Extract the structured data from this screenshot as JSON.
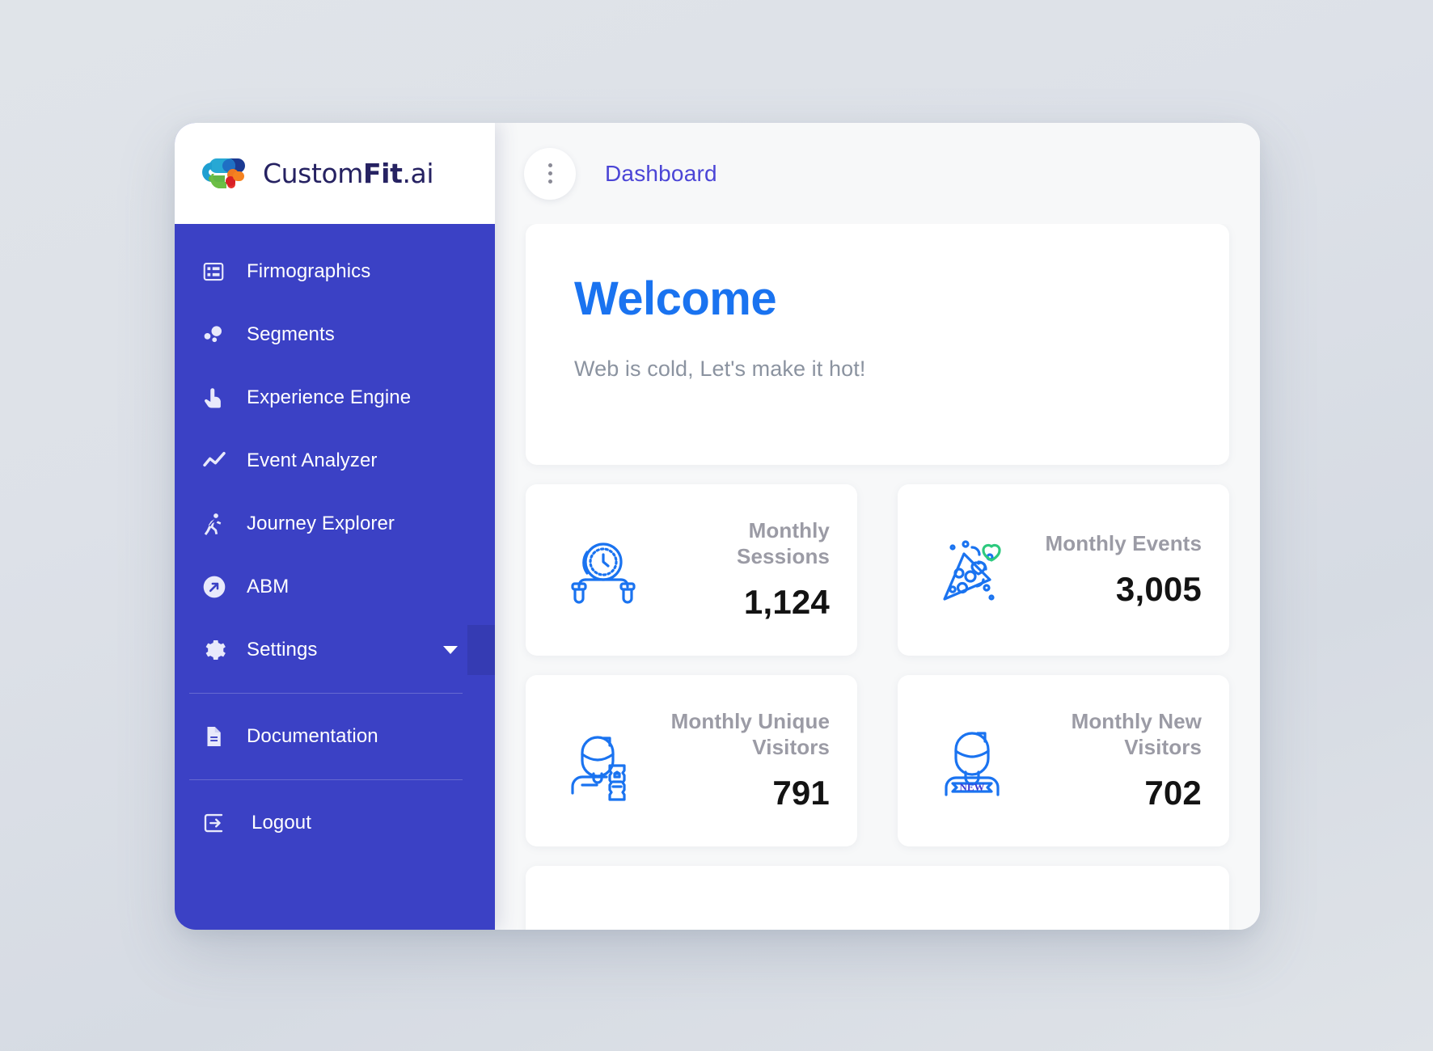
{
  "brand": {
    "name_light": "Custom",
    "name_bold": "Fit",
    "name_suffix": ".ai",
    "logo_icon": "customfit-logo-icon"
  },
  "sidebar": {
    "background_color": "#3b41c5",
    "items": [
      {
        "label": "Firmographics",
        "icon": "list-table-icon"
      },
      {
        "label": "Segments",
        "icon": "bubbles-icon"
      },
      {
        "label": "Experience Engine",
        "icon": "hand-pointer-icon"
      },
      {
        "label": "Event Analyzer",
        "icon": "line-chart-icon"
      },
      {
        "label": "Journey Explorer",
        "icon": "running-person-icon"
      },
      {
        "label": "ABM",
        "icon": "arrow-up-right-circle-icon"
      },
      {
        "label": "Settings",
        "icon": "gear-icon",
        "has_dropdown": true,
        "caret_icon": "chevron-down-icon"
      }
    ],
    "secondary_items": [
      {
        "label": "Documentation",
        "icon": "document-icon"
      }
    ],
    "footer_items": [
      {
        "label": "Logout",
        "icon": "logout-arrow-icon"
      }
    ]
  },
  "topbar": {
    "menu_icon": "kebab-menu-icon",
    "breadcrumb": "Dashboard",
    "breadcrumb_color": "#4b45d6"
  },
  "welcome": {
    "title": "Welcome",
    "title_color": "#1a73f0",
    "subtitle": "Web is cold, Let's make it hot!"
  },
  "stats": [
    {
      "label": "Monthly Sessions",
      "label_line1": "Monthly",
      "label_line2": "Sessions",
      "value": "1,124",
      "icon": "stopwatch-jumprope-icon",
      "icon_color": "#1a73f0"
    },
    {
      "label": "Monthly Events",
      "label_line1": "Monthly Events",
      "label_line2": "",
      "value": "3,005",
      "icon": "party-popper-icon",
      "icon_color": "#1a73f0",
      "icon_accent_color": "#2dc97e"
    },
    {
      "label": "Monthly Unique Visitors",
      "label_line1": "Monthly Unique",
      "label_line2": "Visitors",
      "value": "791",
      "icon": "person-with-ticket-icon",
      "icon_color": "#1a73f0"
    },
    {
      "label": "Monthly New Visitors",
      "label_line1": "Monthly New",
      "label_line2": "Visitors",
      "value": "702",
      "icon": "person-new-badge-icon",
      "icon_color": "#1a73f0",
      "badge_text": "NEW"
    }
  ]
}
